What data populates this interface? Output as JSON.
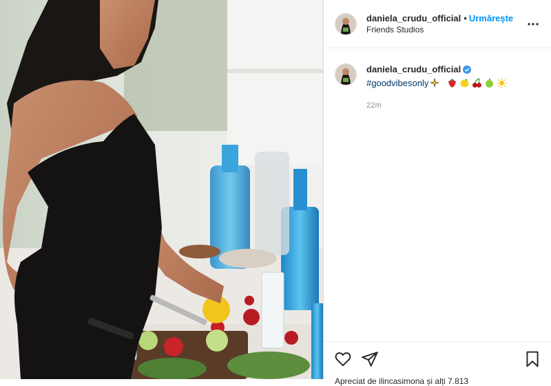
{
  "post": {
    "username": "daniela_crudu_official",
    "follow_label": "Urmărește",
    "location": "Friends Studios",
    "caption": {
      "username": "daniela_crudu_official",
      "hashtag": "#goodvibesonly",
      "emojis": [
        "sparkles",
        "strawberry",
        "lemon",
        "cherries",
        "green-apple",
        "sun"
      ],
      "time": "22m"
    },
    "likes_text": "Apreciat de ilincasimona și alți 7.813"
  },
  "colors": {
    "link_blue": "#0095f6",
    "hashtag": "#00376b",
    "muted": "#8e8e8e",
    "border": "#dbdbdb"
  },
  "icons": [
    "more-options-icon",
    "verified-badge-icon",
    "heart-icon",
    "share-icon",
    "bookmark-icon"
  ]
}
